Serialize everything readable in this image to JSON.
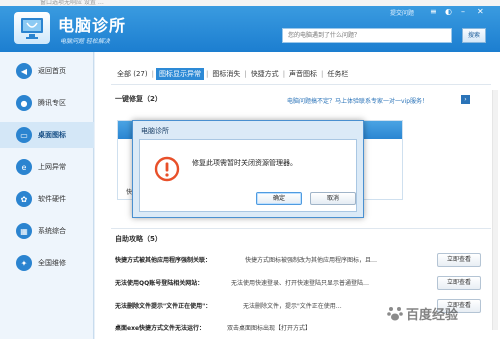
{
  "background_strip": {
    "text": "窗口选项无响应 设置 …"
  },
  "header": {
    "app_title": "电脑诊所",
    "app_subtitle": "电脑问题 轻松解决",
    "submit_question": "提交问题",
    "search_placeholder": "您的电脑遇到了什么问题？",
    "search_button": "搜索",
    "colors": {
      "primary": "#1c7ed0",
      "accent": "#2d8ad6"
    }
  },
  "sidebar": {
    "items": [
      {
        "label": "返回首页",
        "icon": "back-arrow-icon",
        "color": "#2b84d0",
        "glyph": "◀"
      },
      {
        "label": "腾讯专区",
        "icon": "penguin-icon",
        "color": "#2b84d0",
        "glyph": "●"
      },
      {
        "label": "桌面图标",
        "icon": "monitor-icon",
        "color": "#2b84d0",
        "glyph": "▭",
        "active": true
      },
      {
        "label": "上网异常",
        "icon": "ie-icon",
        "color": "#2b84d0",
        "glyph": "e"
      },
      {
        "label": "软件硬件",
        "icon": "gear-icon",
        "color": "#2b84d0",
        "glyph": "✿"
      },
      {
        "label": "系统综合",
        "icon": "windows-icon",
        "color": "#2b84d0",
        "glyph": "▦"
      },
      {
        "label": "全国维修",
        "icon": "wrench-icon",
        "color": "#2b84d0",
        "glyph": "✦"
      }
    ]
  },
  "tabs": {
    "items": [
      "全部 (27)",
      "图标显示异常",
      "图标消失",
      "快捷方式",
      "声音图标",
      "任务栏"
    ],
    "active_index": 1
  },
  "quick_fix": {
    "title": "一键修复（2）",
    "vip_link": "电脑问题搞不定？马上体验联系专家一对一vip服务！",
    "card_text": "快捷"
  },
  "self_help": {
    "title": "自助攻略（5）",
    "rows": [
      {
        "title": "快捷方式被其他应用程序强制关联：",
        "desc": "快捷方式图标被强制改为其他应用程序图标，且…",
        "button": "立即查看"
      },
      {
        "title": "无法使用QQ账号登陆相关网站：",
        "desc": "无法使用快速登录、打开快速登陆只显示普通登陆…",
        "button": "立即查看"
      },
      {
        "title": "无法删除文件提示\"文件正在使用\"：",
        "desc": "无法删除文件，提示\"文件正在使用…",
        "button": "立即查看"
      },
      {
        "title": "桌面exe快捷方式文件无法运行：",
        "desc": "双击桌面图标出现【打开方式】",
        "button": ""
      }
    ]
  },
  "dialog": {
    "title": "电脑诊所",
    "message": "修复此项需暂时关闭资源管理器。",
    "ok_label": "确定",
    "cancel_label": "取消",
    "icon": "warning-icon"
  },
  "watermark": {
    "text": "百度经验"
  }
}
